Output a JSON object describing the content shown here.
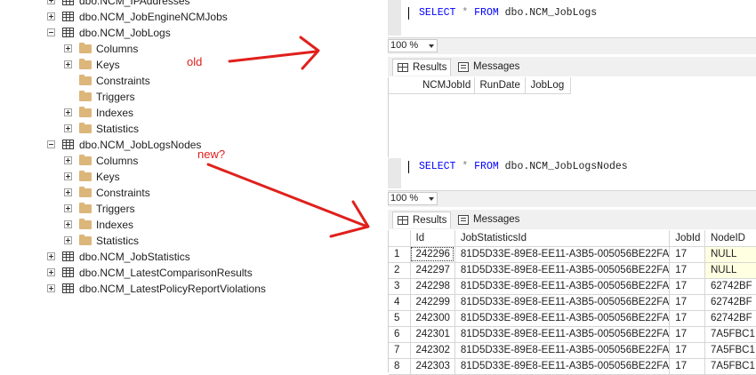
{
  "explorer": {
    "items": [
      {
        "label": "dbo.NCM_IPAddresses",
        "kind": "table",
        "expander": "plus"
      },
      {
        "label": "dbo.NCM_JobEngineNCMJobs",
        "kind": "table",
        "expander": "plus"
      },
      {
        "label": "dbo.NCM_JobLogs",
        "kind": "table",
        "expander": "minus"
      },
      {
        "label": "Columns",
        "kind": "folder",
        "expander": "plus"
      },
      {
        "label": "Keys",
        "kind": "folder",
        "expander": "plus"
      },
      {
        "label": "Constraints",
        "kind": "folder",
        "expander": "none"
      },
      {
        "label": "Triggers",
        "kind": "folder",
        "expander": "none"
      },
      {
        "label": "Indexes",
        "kind": "folder",
        "expander": "plus"
      },
      {
        "label": "Statistics",
        "kind": "folder",
        "expander": "plus"
      },
      {
        "label": "dbo.NCM_JobLogsNodes",
        "kind": "table",
        "expander": "minus"
      },
      {
        "label": "Columns",
        "kind": "folder",
        "expander": "plus"
      },
      {
        "label": "Keys",
        "kind": "folder",
        "expander": "plus"
      },
      {
        "label": "Constraints",
        "kind": "folder",
        "expander": "plus"
      },
      {
        "label": "Triggers",
        "kind": "folder",
        "expander": "plus"
      },
      {
        "label": "Indexes",
        "kind": "folder",
        "expander": "plus"
      },
      {
        "label": "Statistics",
        "kind": "folder",
        "expander": "plus"
      },
      {
        "label": "dbo.NCM_JobStatistics",
        "kind": "table",
        "expander": "plus"
      },
      {
        "label": "dbo.NCM_LatestComparisonResults",
        "kind": "table",
        "expander": "plus"
      },
      {
        "label": "dbo.NCM_LatestPolicyReportViolations",
        "kind": "table",
        "expander": "plus"
      }
    ]
  },
  "annotations": {
    "old_label": "old",
    "new_label": "new?",
    "color": "#e0201c"
  },
  "query1": {
    "keyword": "SELECT",
    "star": "*",
    "from": "FROM",
    "table": "dbo.NCM_JobLogs",
    "zoom": "100 %",
    "tab_results": "Results",
    "tab_messages": "Messages",
    "columns": [
      "NCMJobId",
      "RunDate",
      "JobLog"
    ]
  },
  "query2": {
    "keyword": "SELECT",
    "star": "*",
    "from": "FROM",
    "table": "dbo.NCM_JobLogsNodes",
    "zoom": "100 %",
    "tab_results": "Results",
    "tab_messages": "Messages",
    "columns": [
      "Id",
      "JobStatisticsId",
      "JobId",
      "NodeID"
    ],
    "rows": [
      {
        "n": "1",
        "id": "242296",
        "jsid": "81D5D33E-89E8-EE11-A3B5-005056BE22FA",
        "jobid": "17",
        "node": "NULL"
      },
      {
        "n": "2",
        "id": "242297",
        "jsid": "81D5D33E-89E8-EE11-A3B5-005056BE22FA",
        "jobid": "17",
        "node": "NULL"
      },
      {
        "n": "3",
        "id": "242298",
        "jsid": "81D5D33E-89E8-EE11-A3B5-005056BE22FA",
        "jobid": "17",
        "node": "62742BF"
      },
      {
        "n": "4",
        "id": "242299",
        "jsid": "81D5D33E-89E8-EE11-A3B5-005056BE22FA",
        "jobid": "17",
        "node": "62742BF"
      },
      {
        "n": "5",
        "id": "242300",
        "jsid": "81D5D33E-89E8-EE11-A3B5-005056BE22FA",
        "jobid": "17",
        "node": "62742BF"
      },
      {
        "n": "6",
        "id": "242301",
        "jsid": "81D5D33E-89E8-EE11-A3B5-005056BE22FA",
        "jobid": "17",
        "node": "7A5FBC1"
      },
      {
        "n": "7",
        "id": "242302",
        "jsid": "81D5D33E-89E8-EE11-A3B5-005056BE22FA",
        "jobid": "17",
        "node": "7A5FBC1"
      },
      {
        "n": "8",
        "id": "242303",
        "jsid": "81D5D33E-89E8-EE11-A3B5-005056BE22FA",
        "jobid": "17",
        "node": "7A5FBC1"
      }
    ]
  }
}
